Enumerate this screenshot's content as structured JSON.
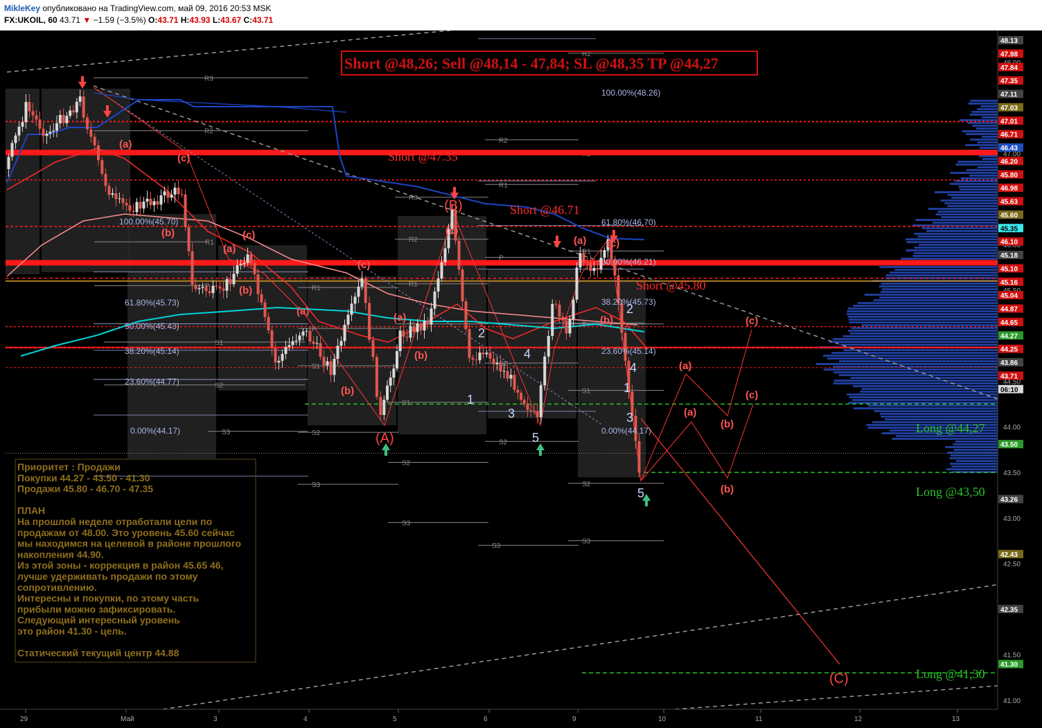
{
  "header": {
    "author": "MikleKey",
    "published": "опубликовано на TradingView.com, май 09, 2016 20:53 MSK",
    "symbol": "FX:UKOIL, 60",
    "last": "43.71",
    "change": "−1.59 (−3.5%)",
    "o_label": "O:",
    "o": "43.71",
    "h_label": "H:",
    "h": "43.93",
    "l_label": "L:",
    "l": "43.67",
    "c_label": "C:",
    "c": "43.71"
  },
  "colors": {
    "background": "#000000",
    "bull": "#d8d8d8",
    "bear": "#e0574f",
    "resistance": "#ff1a1a",
    "support": "#29c229",
    "fib": "#9aa7d8",
    "pivot": "#8a8a8a",
    "volume_profile": "#1f3d99",
    "ma_fast": "#ff2a2a",
    "ma_slow": "#ff8f8f",
    "ma_blue": "#1b46c4",
    "ma_cyan": "#00d5d8",
    "note_text": "#8f6f1c"
  },
  "chart_data": {
    "type": "line",
    "title": "Short @48,26; Sell @48,14 - 47,84; SL @48,35 TP @44,27",
    "ylim": [
      40.9,
      48.35
    ],
    "x_ticks": [
      "29",
      "Май",
      "3",
      "4",
      "5",
      "6",
      "9",
      "10",
      "11",
      "12",
      "13"
    ],
    "y_ticks": [
      "48.00",
      "47.50",
      "47.00",
      "46.50",
      "46.00",
      "45.50",
      "45.00",
      "44.50",
      "44.00",
      "43.50",
      "43.00",
      "42.50",
      "42.00",
      "41.50",
      "41.00"
    ],
    "price_tags": [
      {
        "v": "48.13",
        "bg": "#444444",
        "fg": "#ffffff"
      },
      {
        "v": "47.98",
        "bg": "#d01010",
        "fg": "#ffffff"
      },
      {
        "v": "47.84",
        "bg": "#d01010",
        "fg": "#ffffff"
      },
      {
        "v": "47.35",
        "bg": "#d01010",
        "fg": "#ffffff"
      },
      {
        "v": "47.11",
        "bg": "#444444",
        "fg": "#ffffff"
      },
      {
        "v": "47.03",
        "bg": "#7a6a1a",
        "fg": "#ffffff"
      },
      {
        "v": "47.01",
        "bg": "#d01010",
        "fg": "#ffffff"
      },
      {
        "v": "46.71",
        "bg": "#d01010",
        "fg": "#ffffff"
      },
      {
        "v": "46.43",
        "bg": "#1f4fc0",
        "fg": "#ffffff"
      },
      {
        "v": "46.20",
        "bg": "#d01010",
        "fg": "#ffffff"
      },
      {
        "v": "45.80",
        "bg": "#d01010",
        "fg": "#ffffff"
      },
      {
        "v": "46.98",
        "bg": "#d01010",
        "fg": "#ffffff"
      },
      {
        "v": "45.63",
        "bg": "#d01010",
        "fg": "#ffffff"
      },
      {
        "v": "45.60",
        "bg": "#7a6a1a",
        "fg": "#ffffff"
      },
      {
        "v": "45.35",
        "bg": "#3ae8ee",
        "fg": "#000000"
      },
      {
        "v": "46.10",
        "bg": "#d01010",
        "fg": "#ffffff"
      },
      {
        "v": "45.18",
        "bg": "#444444",
        "fg": "#ffffff"
      },
      {
        "v": "45.10",
        "bg": "#d01010",
        "fg": "#ffffff"
      },
      {
        "v": "45.16",
        "bg": "#d01010",
        "fg": "#ffffff"
      },
      {
        "v": "45.04",
        "bg": "#d01010",
        "fg": "#ffffff"
      },
      {
        "v": "44.87",
        "bg": "#d01010",
        "fg": "#ffffff"
      },
      {
        "v": "44.65",
        "bg": "#d01010",
        "fg": "#ffffff"
      },
      {
        "v": "44.27",
        "bg": "#2b9a2b",
        "fg": "#ffffff"
      },
      {
        "v": "44.25",
        "bg": "#d01010",
        "fg": "#ffffff"
      },
      {
        "v": "43.86",
        "bg": "#444444",
        "fg": "#ffffff"
      },
      {
        "v": "43.71",
        "bg": "#d01010",
        "fg": "#ffffff"
      },
      {
        "v": "06:10",
        "bg": "#d8d8d8",
        "fg": "#000000"
      },
      {
        "v": "43.50",
        "bg": "#2b9a2b",
        "fg": "#ffffff"
      },
      {
        "v": "43.26",
        "bg": "#444444",
        "fg": "#ffffff"
      },
      {
        "v": "42.43",
        "bg": "#7a6a1a",
        "fg": "#ffffff"
      },
      {
        "v": "42.35",
        "bg": "#444444",
        "fg": "#ffffff"
      },
      {
        "v": "41.30",
        "bg": "#2b9a2b",
        "fg": "#ffffff"
      }
    ],
    "levels": [
      {
        "label": "Short @47.35",
        "price": 46.3,
        "kind": "resistance"
      },
      {
        "label": "Short @46.71",
        "price": 45.45,
        "kind": "resistance"
      },
      {
        "label": "Short @45.80",
        "price": 44.55,
        "kind": "resistance"
      },
      {
        "label": "Long @44,27",
        "price": 43.05,
        "kind": "support"
      },
      {
        "label": "Long @43,50",
        "price": 42.3,
        "kind": "support"
      },
      {
        "label": "Long @41,30",
        "price": 40.5,
        "kind": "support"
      }
    ],
    "fib_left": [
      {
        "label": "100.00%(45.70)"
      },
      {
        "label": "61.80%(45.73)"
      },
      {
        "label": "50.00%(45.43)"
      },
      {
        "label": "38.20%(45.14)"
      },
      {
        "label": "23.60%(44.77)"
      },
      {
        "label": "0.00%(44.17)"
      }
    ],
    "fib_right": [
      {
        "label": "100.00%(48.26)"
      },
      {
        "label": "61.80%(46.70)"
      },
      {
        "label": "50.00%(46.21)"
      },
      {
        "label": "38.20%(45.73)"
      },
      {
        "label": "23.60%(45.14)"
      },
      {
        "label": "0.00%(44.17)"
      }
    ],
    "waves": {
      "A": "(A)",
      "B": "(B)",
      "C": "(C)",
      "a": "(a)",
      "b": "(b)",
      "c": "(c)",
      "n1": "1",
      "n2": "2",
      "n3": "3",
      "n4": "4",
      "n5": "5"
    },
    "pivots": {
      "R1": "R1",
      "R2": "R2",
      "R3": "R3",
      "P": "P",
      "S1": "S1",
      "S2": "S2",
      "S3": "S3"
    }
  },
  "note": {
    "lines": [
      "Приоритет : Продажи",
      "Покупки 44.27 - 43.50 - 41.30",
      "Продажи 45.80 - 46.70 - 47.35",
      "",
      "ПЛАН",
      "На прошлой неделе отработали цели по",
      "продажам от 48.00. Это уровень 45.60 сейчас",
      "мы находимся на целевой в районе прошлого",
      "накопления 44.90.",
      "Из этой зоны - коррекция в район 45.65 46,",
      "лучше удерживать продажи по этому",
      "сопротивлению.",
      "Интересны и покупки, по этому часть",
      "прибыли можно зафиксировать.",
      "Следующий интересный уровень",
      "это район 41.30 - цель.",
      "",
      "Статический текущий центр 44.88"
    ]
  }
}
